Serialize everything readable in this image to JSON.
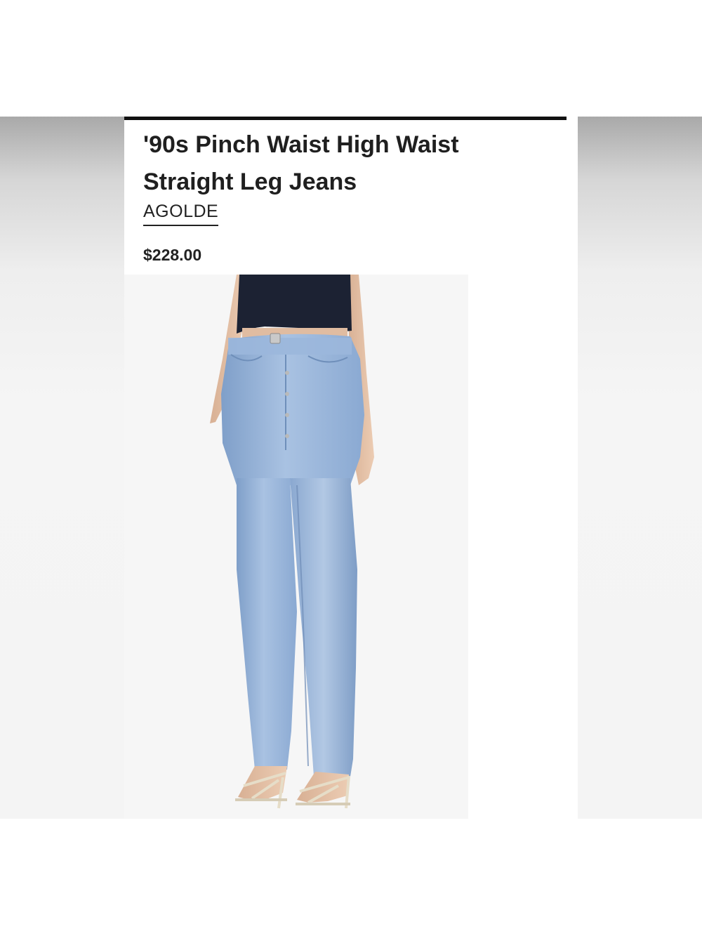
{
  "product": {
    "title": "'90s Pinch Waist High Waist Straight Leg Jeans",
    "brand": "AGOLDE",
    "price": "$228.00"
  },
  "image": {
    "icon": "product-photo-jeans",
    "colors": {
      "top": "#1c2233",
      "denim": "#8fb0d8",
      "skin": "#e5c3a8"
    }
  }
}
